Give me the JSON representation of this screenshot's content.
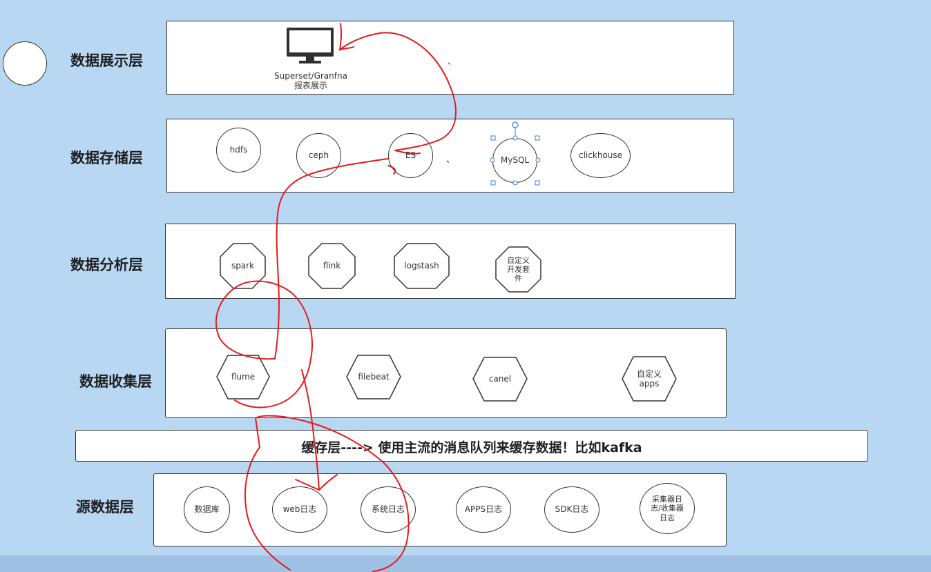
{
  "layers": {
    "display": {
      "label": "数据展示层"
    },
    "storage": {
      "label": "数据存储层"
    },
    "analysis": {
      "label": "数据分析层"
    },
    "collection": {
      "label": "数据收集层"
    },
    "source": {
      "label": "源数据层"
    }
  },
  "cache_bar": {
    "text": "缓存层----> 使用主流的消息队列来缓存数据！比如kafka"
  },
  "display_nodes": {
    "monitor_line1": "Superset/Granfna",
    "monitor_line2": "报表展示"
  },
  "storage_nodes": [
    "hdfs",
    "ceph",
    "ES",
    "MySQL",
    "clickhouse"
  ],
  "analysis_nodes": [
    "spark",
    "flink",
    "logstash",
    "自定义\n开发套\n件"
  ],
  "collection_nodes": [
    "flume",
    "filebeat",
    "canel",
    "自定义\napps"
  ],
  "source_nodes": [
    "数据库",
    "web日志",
    "系统日志",
    "APPS日志",
    "SDK日志",
    "采集器日\n志/收集器\n日志"
  ],
  "stray_marks": {
    "tick": "、"
  },
  "colors": {
    "background": "#b8d7f3",
    "panel": "#ffffff",
    "annotation": "#e8191b",
    "selection": "#3b7fd4"
  }
}
